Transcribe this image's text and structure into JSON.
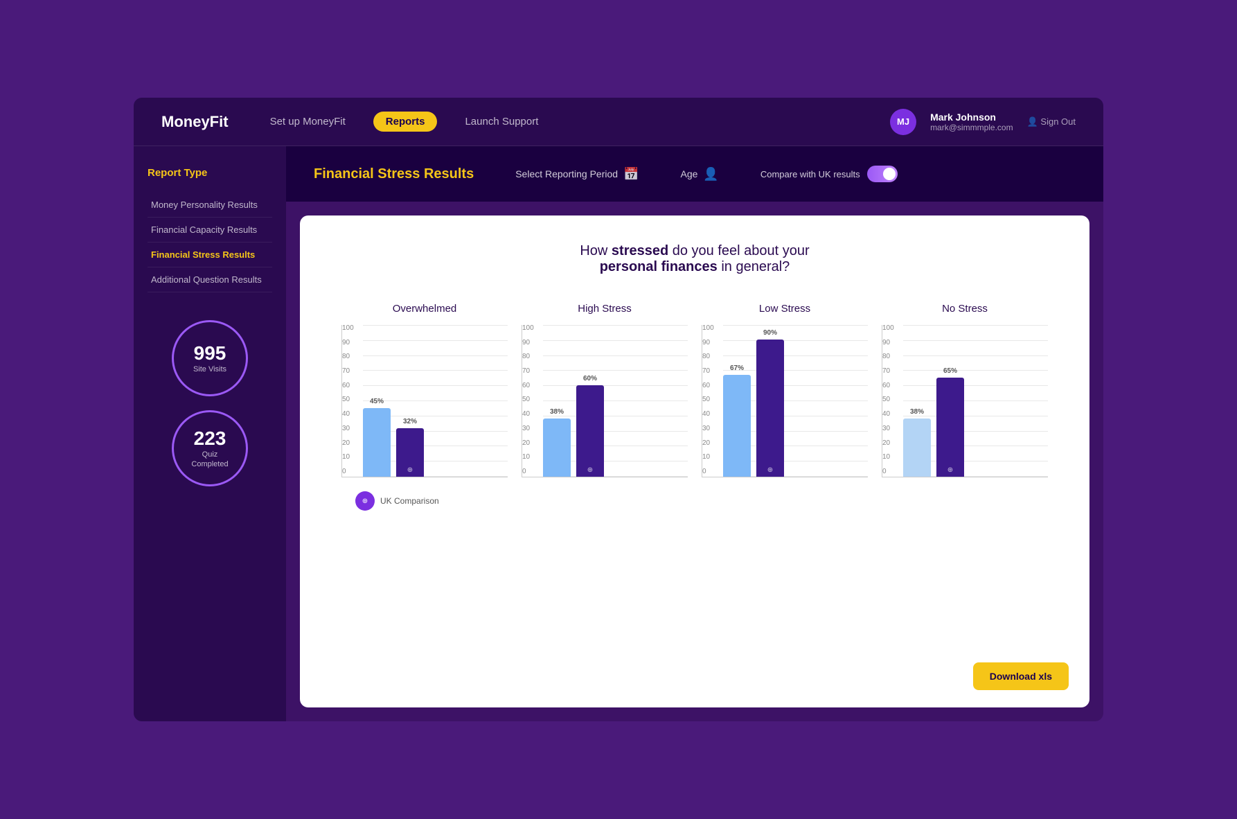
{
  "app": {
    "logo": "MoneyFit",
    "nav": {
      "setup": "Set up MoneyFit",
      "reports": "Reports",
      "launch_support": "Launch Support"
    },
    "user": {
      "initials": "MJ",
      "name": "Mark Johnson",
      "email": "mark@simmmple.com",
      "sign_out": "Sign Out"
    }
  },
  "sidebar": {
    "title": "Report Type",
    "items": [
      {
        "id": "money-personality",
        "label": "Money Personality Results",
        "active": false
      },
      {
        "id": "financial-capacity",
        "label": "Financial Capacity Results",
        "active": false
      },
      {
        "id": "financial-stress",
        "label": "Financial Stress Results",
        "active": true
      },
      {
        "id": "additional-question",
        "label": "Additional Question Results",
        "active": false
      }
    ],
    "stats": [
      {
        "id": "site-visits",
        "number": "995",
        "label": "Site Visits"
      },
      {
        "id": "quiz-completed",
        "number": "223",
        "label": "Quiz\nCompleted"
      }
    ]
  },
  "sub_header": {
    "title": "Financial Stress Results",
    "controls": {
      "reporting_period": "Select Reporting Period",
      "age": "Age",
      "compare_label": "Compare with UK results"
    }
  },
  "chart": {
    "question_pre": "How ",
    "question_bold": "stressed",
    "question_mid": " do you feel about your",
    "question_bold2": "personal finances",
    "question_end": " in general?",
    "groups": [
      {
        "id": "overwhelmed",
        "title": "Overwhelmed",
        "bars": [
          {
            "value": 45,
            "label": "45%",
            "color": "blue-light"
          },
          {
            "value": 32,
            "label": "32%",
            "color": "purple-dark"
          }
        ]
      },
      {
        "id": "high-stress",
        "title": "High Stress",
        "bars": [
          {
            "value": 38,
            "label": "38%",
            "color": "blue-light"
          },
          {
            "value": 60,
            "label": "60%",
            "color": "purple-dark"
          }
        ]
      },
      {
        "id": "low-stress",
        "title": "Low Stress",
        "bars": [
          {
            "value": 67,
            "label": "67%",
            "color": "blue-light"
          },
          {
            "value": 90,
            "label": "90%",
            "color": "purple-dark"
          }
        ]
      },
      {
        "id": "no-stress",
        "title": "No Stress",
        "bars": [
          {
            "value": 38,
            "label": "38%",
            "color": "blue-pale"
          },
          {
            "value": 65,
            "label": "65%",
            "color": "purple-dark"
          }
        ]
      }
    ],
    "y_axis_labels": [
      "0",
      "10",
      "20",
      "30",
      "40",
      "50",
      "60",
      "70",
      "80",
      "90",
      "100"
    ],
    "legend": {
      "icon_text": "⊕",
      "label": "UK Comparison"
    },
    "download_btn": "Download xls"
  }
}
